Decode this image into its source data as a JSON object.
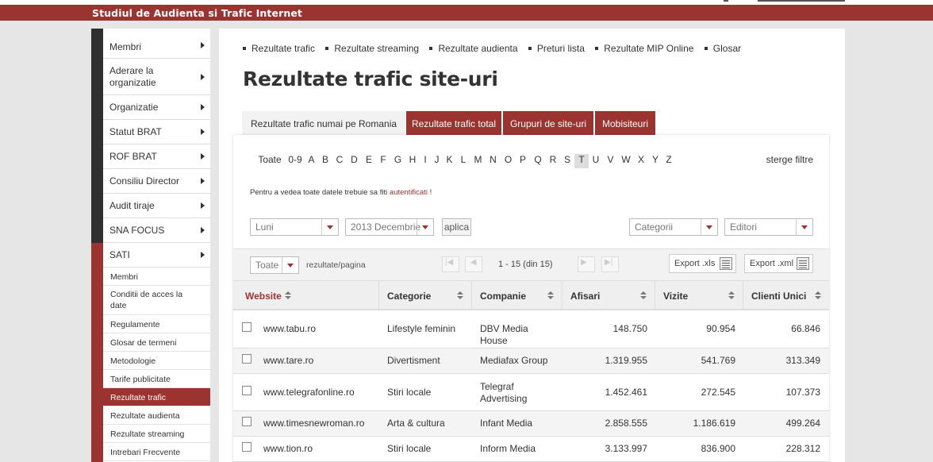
{
  "site_title": "Studiul de Audienta si Trafic Internet",
  "sidebar": {
    "items": [
      {
        "label": "Membri"
      },
      {
        "label": "Aderare la organizatie"
      },
      {
        "label": "Organizatie"
      },
      {
        "label": "Statut BRAT"
      },
      {
        "label": "ROF BRAT"
      },
      {
        "label": "Consiliu Director"
      },
      {
        "label": "Audit tiraje"
      },
      {
        "label": "SNA FOCUS"
      },
      {
        "label": "SATI"
      }
    ],
    "subitems": [
      {
        "label": "Membri"
      },
      {
        "label": "Conditii de acces la date"
      },
      {
        "label": "Regulamente"
      },
      {
        "label": "Glosar de termeni"
      },
      {
        "label": "Metodologie"
      },
      {
        "label": "Tarife publicitate"
      },
      {
        "label": "Rezultate trafic"
      },
      {
        "label": "Rezultate audienta"
      },
      {
        "label": "Rezultate streaming"
      },
      {
        "label": "Intrebari Frecvente"
      }
    ]
  },
  "topnav": [
    "Rezultate trafic",
    "Rezultate streaming",
    "Rezultate audienta",
    "Preturi lista",
    "Rezultate MIP Online",
    "Glosar"
  ],
  "page_title": "Rezultate trafic site-uri",
  "tabs": [
    "Rezultate trafic numai pe Romania",
    "Rezultate trafic total",
    "Grupuri de site-uri",
    "Mobisiteuri"
  ],
  "letters": [
    "Toate",
    "0-9",
    "A",
    "B",
    "C",
    "D",
    "E",
    "F",
    "G",
    "H",
    "I",
    "J",
    "K",
    "L",
    "M",
    "N",
    "O",
    "P",
    "Q",
    "R",
    "S",
    "T",
    "U",
    "V",
    "W",
    "X",
    "Y",
    "Z"
  ],
  "selected_letter": "T",
  "clear_filters": "sterge filtre",
  "auth_note": {
    "text": "Pentru a vedea toate datele trebuie sa fiti",
    "link": "autentificati",
    "suffix": "!"
  },
  "filters": {
    "period": "Luni",
    "month": "2013 Decembrie",
    "apply": "aplica",
    "category": "Categorii",
    "publisher": "Editori"
  },
  "toolbar": {
    "per_page_value": "Toate",
    "per_page_label": "rezultate/pagina",
    "page_info": "1 - 15 (din 15)",
    "export_xls": "Export .xls",
    "export_xml": "Export .xml"
  },
  "table": {
    "columns": [
      "Website",
      "Categorie",
      "Companie",
      "Afisari",
      "Vizite",
      "Clienti Unici"
    ],
    "rows": [
      {
        "website": "www.tabu.ro",
        "categorie": "Lifestyle feminin",
        "companie": "DBV Media House",
        "afisari": "148.750",
        "vizite": "90.954",
        "clienti": "66.846"
      },
      {
        "website": "www.tare.ro",
        "categorie": "Divertisment",
        "companie": "Mediafax Group",
        "afisari": "1.319.955",
        "vizite": "541.769",
        "clienti": "313.349"
      },
      {
        "website": "www.telegrafonline.ro",
        "categorie": "Stiri locale",
        "companie": "Telegraf Advertising",
        "afisari": "1.452.461",
        "vizite": "272.545",
        "clienti": "107.373"
      },
      {
        "website": "www.timesnewroman.ro",
        "categorie": "Arta & cultura",
        "companie": "Infant Media",
        "afisari": "2.858.555",
        "vizite": "1.186.619",
        "clienti": "499.264"
      },
      {
        "website": "www.tion.ro",
        "categorie": "Stiri locale",
        "companie": "Inform Media",
        "afisari": "3.133.997",
        "vizite": "836.900",
        "clienti": "228.312"
      }
    ]
  }
}
